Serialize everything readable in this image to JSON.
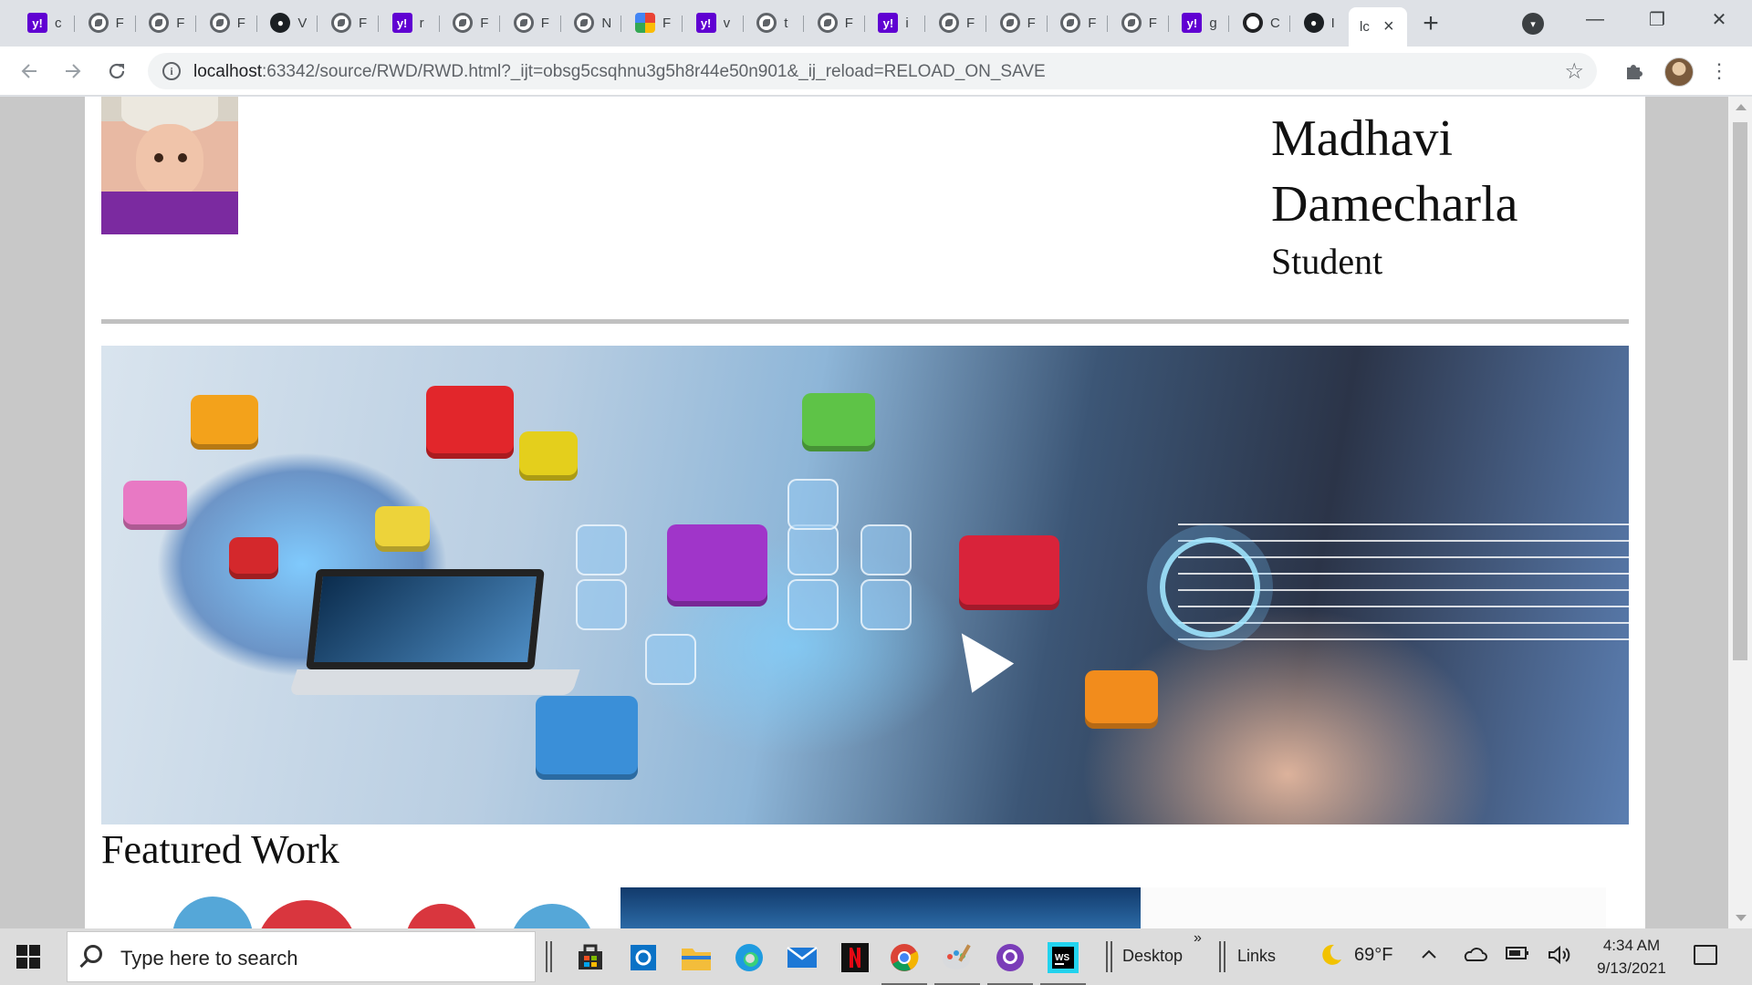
{
  "browser": {
    "tabs": [
      {
        "icon": "yahoo-icon",
        "title": "c"
      },
      {
        "icon": "globe-icon",
        "title": "F"
      },
      {
        "icon": "globe-icon",
        "title": "F"
      },
      {
        "icon": "globe-icon",
        "title": "F"
      },
      {
        "icon": "github-icon",
        "title": "V"
      },
      {
        "icon": "globe-icon",
        "title": "F"
      },
      {
        "icon": "yahoo-icon",
        "title": "r"
      },
      {
        "icon": "globe-icon",
        "title": "F"
      },
      {
        "icon": "globe-icon",
        "title": "F"
      },
      {
        "icon": "globe-icon",
        "title": "N"
      },
      {
        "icon": "photos-icon",
        "title": "F"
      },
      {
        "icon": "yahoo-icon",
        "title": "v"
      },
      {
        "icon": "globe-icon",
        "title": "t"
      },
      {
        "icon": "globe-icon",
        "title": "F"
      },
      {
        "icon": "yahoo-icon",
        "title": "i"
      },
      {
        "icon": "globe-icon",
        "title": "F"
      },
      {
        "icon": "globe-icon",
        "title": "F"
      },
      {
        "icon": "globe-icon",
        "title": "F"
      },
      {
        "icon": "globe-icon",
        "title": "F"
      },
      {
        "icon": "yahoo-icon",
        "title": "g"
      },
      {
        "icon": "ring-icon",
        "title": "C"
      },
      {
        "icon": "github-icon",
        "title": "I"
      }
    ],
    "active_tab": {
      "title": "lc",
      "close": "×"
    },
    "new_tab": "+",
    "address": {
      "host": "localhost",
      "rest": ":63342/source/RWD/RWD.html?_ijt=obsg5csqhnu3g5h8r44e50n901&_ij_reload=RELOAD_ON_SAVE"
    },
    "window": {
      "minimize": "—",
      "restore": "❐",
      "close": "✕"
    }
  },
  "page": {
    "name_line1": "Madhavi",
    "name_line2": "Damecharla",
    "role": "Student",
    "featured_heading": "Featured Work"
  },
  "taskbar": {
    "search_placeholder": "Type here to search",
    "desktop_label": "Desktop",
    "links_label": "Links",
    "overflow": "»",
    "weather": "69°F",
    "time": "4:34 AM",
    "date": "9/13/2021",
    "apps": [
      "store-icon",
      "outlook-icon",
      "file-explorer-icon",
      "edge-icon",
      "mail-icon",
      "netflix-icon",
      "chrome-icon",
      "paint-icon",
      "github-desktop-icon",
      "webstorm-icon"
    ]
  },
  "colors": {
    "yahoo": "#6001d2",
    "taskbar": "#dcdcdc",
    "tabstrip": "#dee1e6"
  }
}
